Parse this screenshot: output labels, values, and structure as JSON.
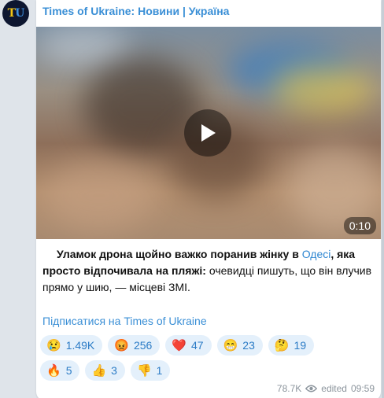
{
  "channel": {
    "name": "Times of Ukraine: Новини | Україна",
    "avatar_left": "T",
    "avatar_right": "U"
  },
  "video": {
    "duration": "0:10"
  },
  "message": {
    "part1_bold": "Уламок дрона щойно важко поранив жінку в ",
    "link": "Одесі",
    "part2_bold": ", яка просто відпочивала на пляжі:",
    "part3": " очевидці пишуть, що він влучив прямо у шию, — місцеві ЗМІ."
  },
  "subscribe_link": "Підписатися на Times of Ukraine",
  "reactions": [
    {
      "emoji": "😢",
      "count": "1.49K"
    },
    {
      "emoji": "😡",
      "count": "256"
    },
    {
      "emoji": "❤️",
      "count": "47"
    },
    {
      "emoji": "😁",
      "count": "23"
    },
    {
      "emoji": "🤔",
      "count": "19"
    },
    {
      "emoji": "🔥",
      "count": "5"
    },
    {
      "emoji": "👍",
      "count": "3"
    },
    {
      "emoji": "👎",
      "count": "1"
    }
  ],
  "meta": {
    "views": "78.7K",
    "edited": "edited",
    "time": "09:59",
    "views_icon": "eye-icon"
  },
  "colors": {
    "accent": "#3a8fd6",
    "reaction_bg": "#e4f0fb",
    "page_bg": "#dfe4ea"
  }
}
